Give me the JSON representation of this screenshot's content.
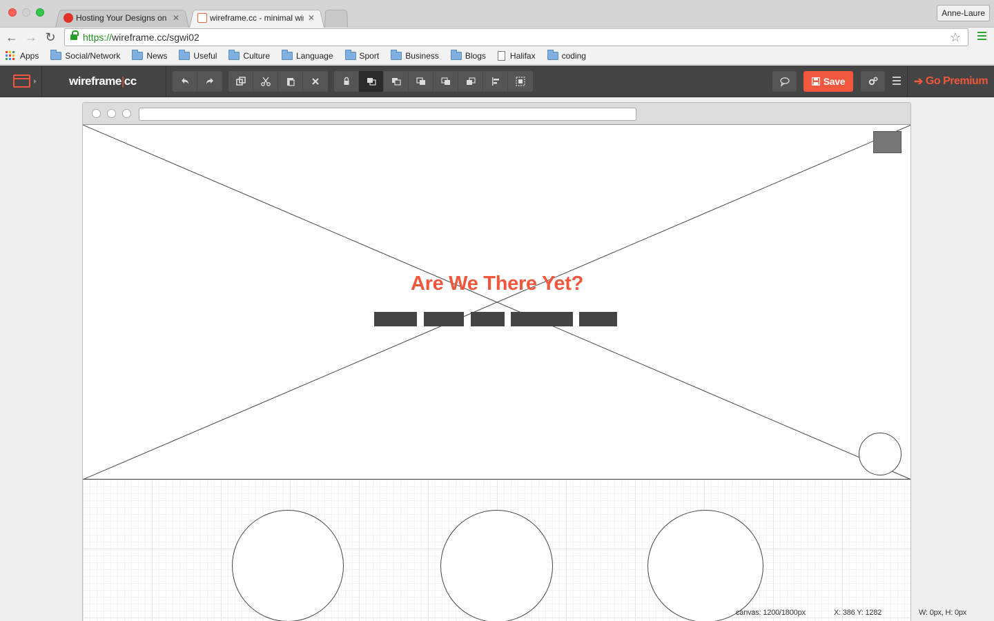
{
  "browser": {
    "tabs": [
      {
        "label": "Hosting Your Designs on | |",
        "active": false,
        "favicon_color": "#e0322b"
      },
      {
        "label": "wireframe.cc - minimal wire",
        "active": true,
        "favicon_color": "#e8643c"
      }
    ],
    "profile_name": "Anne-Laure",
    "url_scheme": "https://",
    "url_rest": "wireframe.cc/sgwi02",
    "bookmarks": [
      {
        "label": "Apps",
        "icon": "apps-grid-icon"
      },
      {
        "label": "Social/Network",
        "icon": "folder-icon"
      },
      {
        "label": "News",
        "icon": "folder-icon"
      },
      {
        "label": "Useful",
        "icon": "folder-icon"
      },
      {
        "label": "Culture",
        "icon": "folder-icon"
      },
      {
        "label": "Language",
        "icon": "folder-icon"
      },
      {
        "label": "Sport",
        "icon": "folder-icon"
      },
      {
        "label": "Business",
        "icon": "folder-icon"
      },
      {
        "label": "Blogs",
        "icon": "folder-icon"
      },
      {
        "label": "Halifax",
        "icon": "page-icon"
      },
      {
        "label": "coding",
        "icon": "folder-icon"
      }
    ]
  },
  "app": {
    "name_left": "wireframe",
    "name_sep": "|",
    "name_right": "cc",
    "save_label": "Save",
    "premium_label": "Go Premium",
    "accent_color": "#f0573c",
    "history_tools": [
      "undo-icon",
      "redo-icon"
    ],
    "edit_tools": [
      "duplicate-icon",
      "cut-icon",
      "paste-icon",
      "delete-icon"
    ],
    "arrange_tools": [
      "lock-icon",
      "send-to-back-icon",
      "send-backward-icon",
      "bring-forward-icon",
      "bring-to-front-icon",
      "flip-icon",
      "align-icon",
      "group-icon"
    ],
    "active_arrange_tool": "send-to-back-icon"
  },
  "canvas": {
    "hero_title": "Are We There Yet?",
    "nav_item_count": 5
  },
  "status_bar": {
    "canvas_size": "canvas: 1200/1800px",
    "cursor": "X: 386 Y: 1282",
    "selection_size": "W: 0px, H: 0px"
  }
}
